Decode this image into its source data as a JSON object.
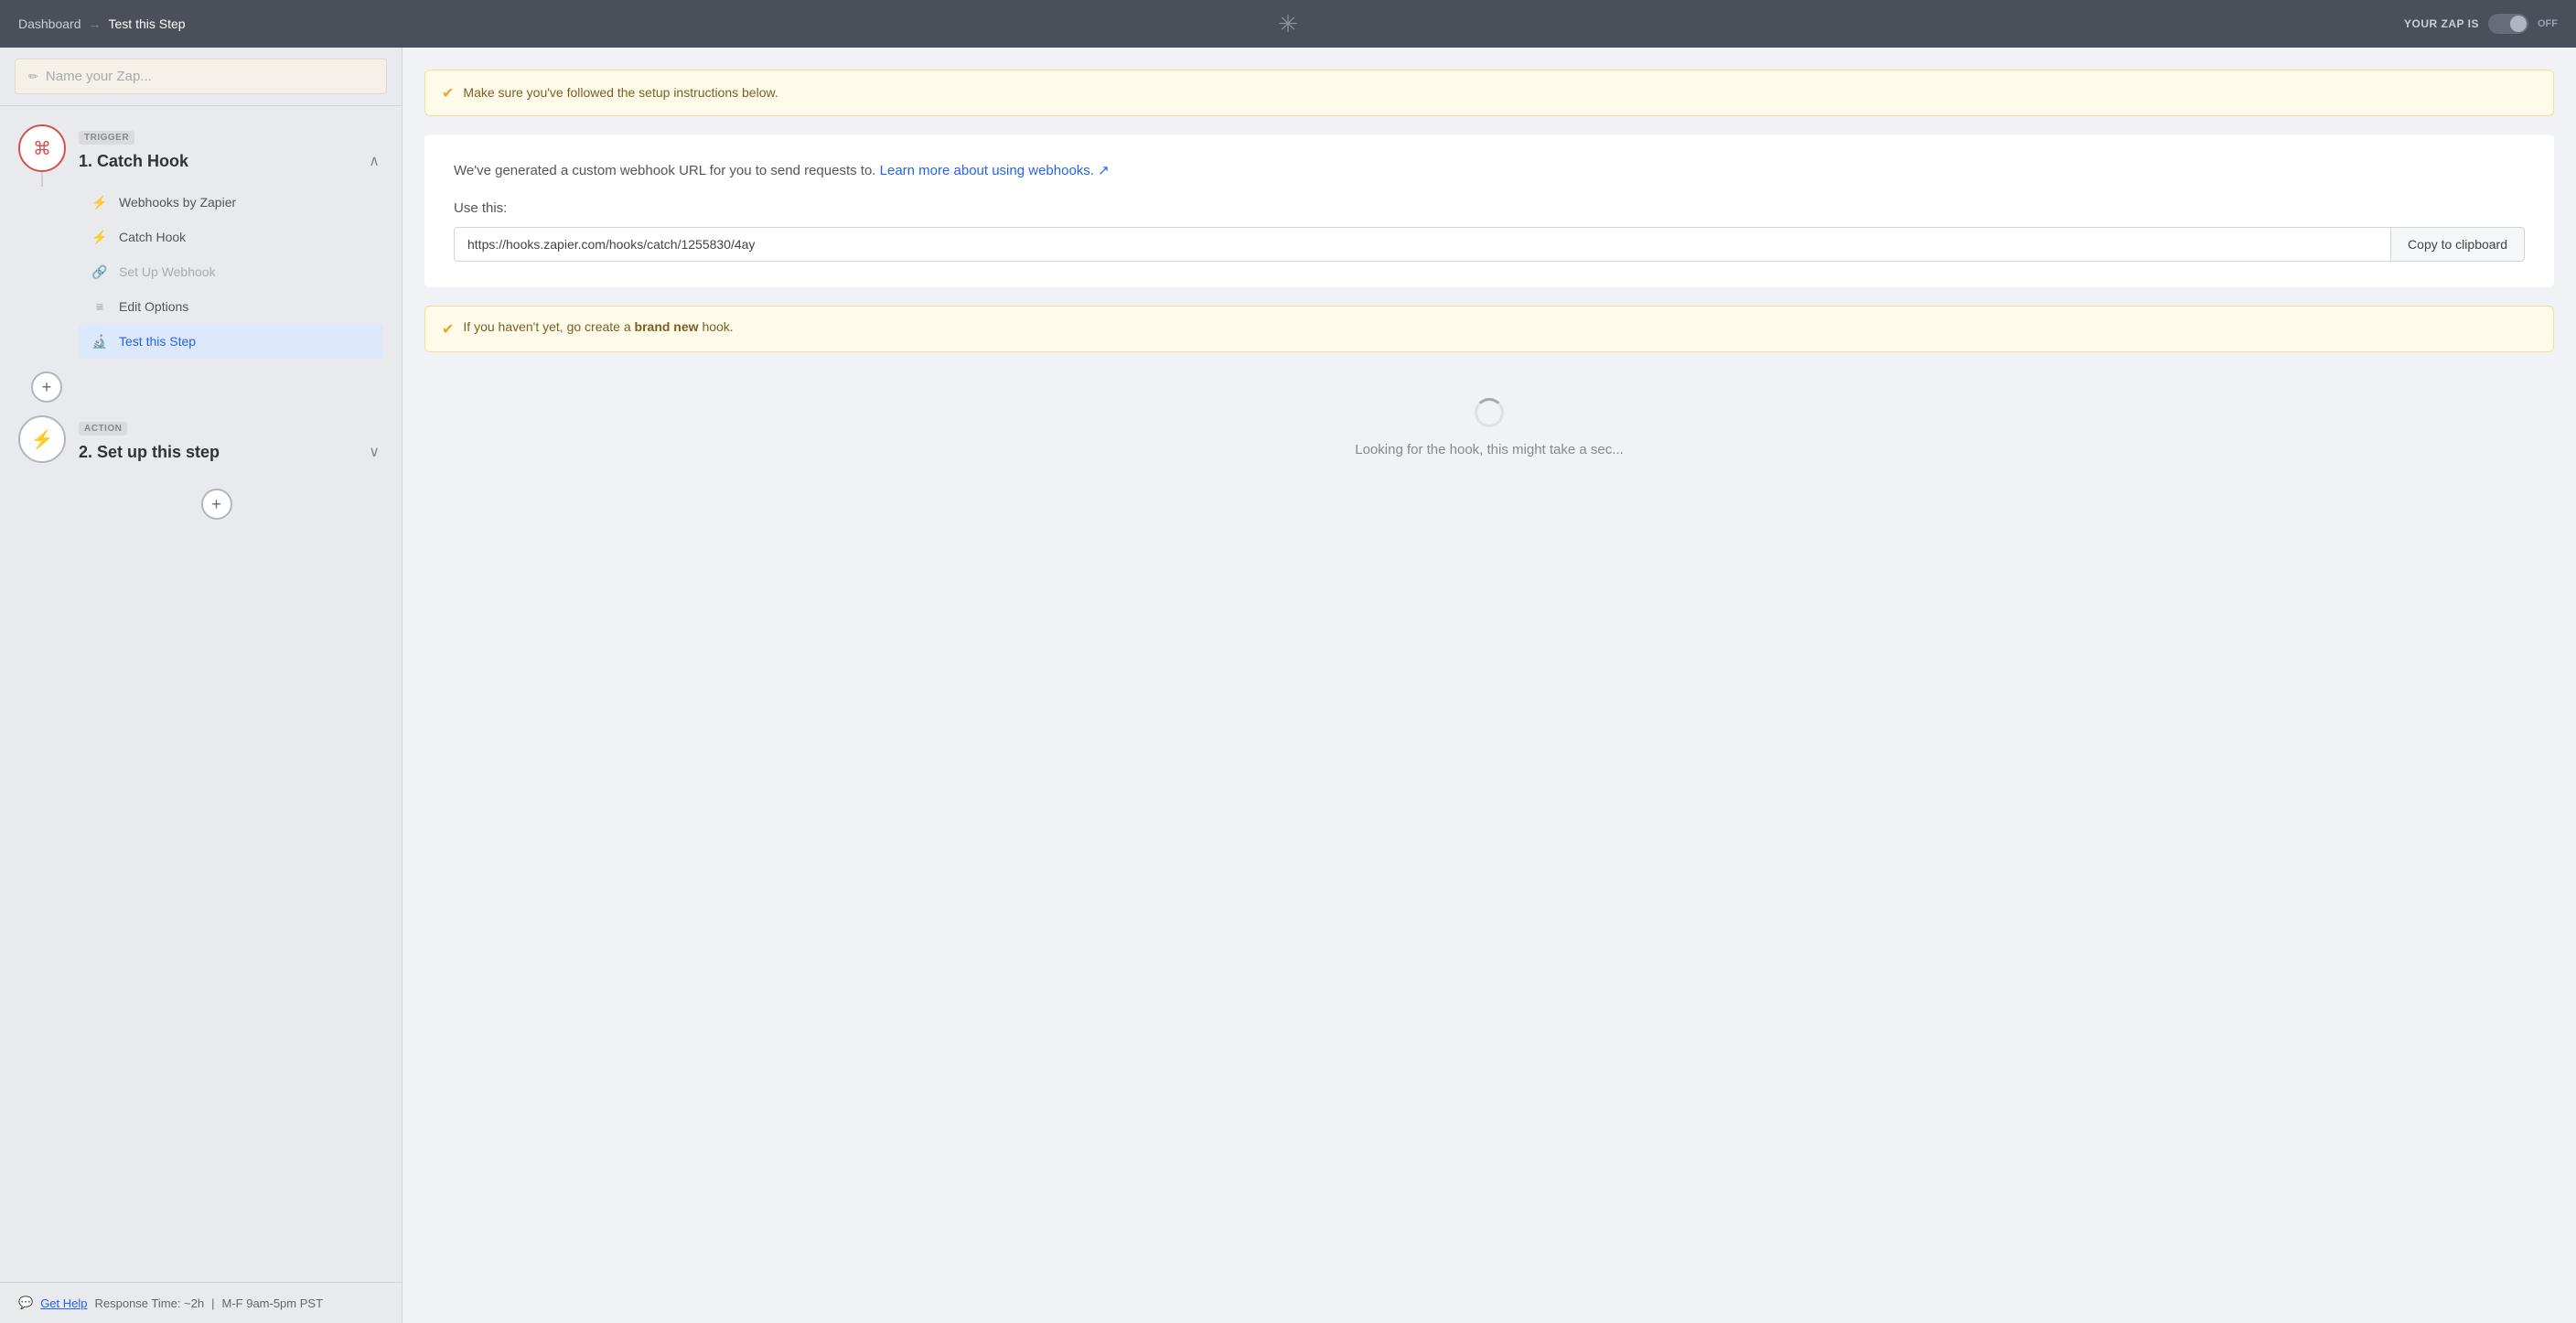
{
  "nav": {
    "dashboard_label": "Dashboard",
    "arrow": "→",
    "current_page": "Test this Step",
    "logo_symbol": "✳",
    "zap_status_label": "YOUR ZAP IS",
    "toggle_state": "OFF"
  },
  "sidebar": {
    "zap_name_placeholder": "Name your Zap...",
    "pencil_symbol": "✏",
    "trigger": {
      "badge": "TRIGGER",
      "step_number": "1.",
      "step_name": "Catch Hook",
      "sub_items": [
        {
          "id": "webhooks",
          "label": "Webhooks by Zapier",
          "icon": "⚡",
          "icon_type": "orange",
          "active": false
        },
        {
          "id": "catch-hook",
          "label": "Catch Hook",
          "icon": "⚡",
          "icon_type": "gray",
          "active": false
        },
        {
          "id": "set-up",
          "label": "Set Up Webhook",
          "icon": "🔗",
          "icon_type": "gray",
          "active": false,
          "muted": true
        },
        {
          "id": "edit-options",
          "label": "Edit Options",
          "icon": "≡",
          "icon_type": "gray",
          "active": false
        },
        {
          "id": "test-step",
          "label": "Test this Step",
          "icon": "🔬",
          "icon_type": "blue",
          "active": true
        }
      ]
    },
    "action": {
      "badge": "ACTION",
      "step_number": "2.",
      "step_name": "Set up this step"
    },
    "footer": {
      "chat_symbol": "💬",
      "text": "Get Help",
      "separator": "|",
      "response_time": "Response Time: ~2h",
      "hours": "M-F 9am-5pm PST"
    }
  },
  "content": {
    "top_banner": {
      "icon": "✔",
      "text": "Make sure you've followed the setup instructions below."
    },
    "main_card": {
      "description_part1": "We've generated a custom webhook URL for you to send requests to.",
      "description_link": "Learn more about using webhooks.",
      "description_link_symbol": "↗",
      "use_this_label": "Use this:",
      "webhook_url": "https://hooks.zapier.com/hooks/catch/1255830/4ay",
      "copy_button_label": "Copy to clipboard"
    },
    "bottom_banner": {
      "icon": "✔",
      "text_before": "If you haven't yet, go create a",
      "link_text": "brand new",
      "text_after": "hook."
    },
    "loading": {
      "text": "Looking for the hook, this might take a sec..."
    }
  }
}
